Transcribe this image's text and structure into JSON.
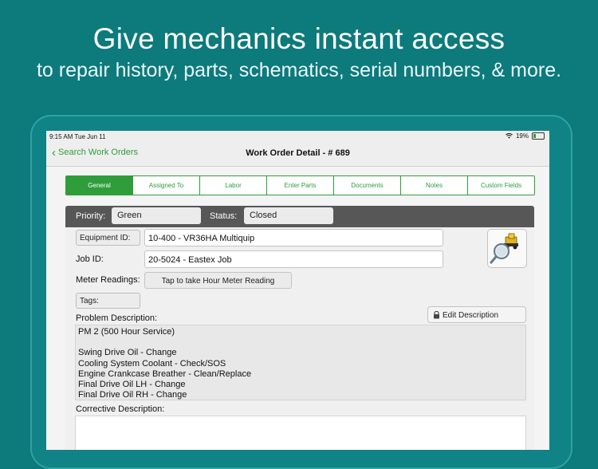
{
  "promo": {
    "title": "Give mechanics instant access",
    "subtitle": "to repair history, parts, schematics, serial numbers, & more."
  },
  "statusbar": {
    "time": "9:15 AM  Tue Jun 11",
    "battery": "19%"
  },
  "nav": {
    "back_label": "Search Work Orders",
    "title": "Work Order Detail - # 689"
  },
  "tabs": [
    {
      "label": "General",
      "active": true
    },
    {
      "label": "Assigned To"
    },
    {
      "label": "Labor"
    },
    {
      "label": "Enter Parts"
    },
    {
      "label": "Documents"
    },
    {
      "label": "Notes"
    },
    {
      "label": "Custom Fields"
    }
  ],
  "header": {
    "priority_label": "Priority:",
    "priority_value": "Green",
    "status_label": "Status:",
    "status_value": "Closed"
  },
  "fields": {
    "equipment_label": "Equipment ID:",
    "equipment_value": "10-400  - VR36HA Multiquip",
    "job_label": "Job ID:",
    "job_value": "20-5024 - Eastex Job",
    "meter_label": "Meter Readings:",
    "meter_button": "Tap to take Hour Meter Reading",
    "tags_label": "Tags:"
  },
  "problem": {
    "label": "Problem Description:",
    "edit_button": "Edit Description",
    "lines": [
      "PM 2 (500 Hour Service)",
      "",
      "Swing Drive Oil - Change",
      "Cooling System Coolant - Check/SOS",
      "Engine Crankcase Breather - Clean/Replace",
      "Final Drive Oil LH - Change",
      "Final Drive Oil RH - Change"
    ]
  },
  "corrective": {
    "label": "Corrective Description:",
    "value": ""
  },
  "colors": {
    "background": "#0d7a7c",
    "accent": "#2e9d3a",
    "header": "#575757"
  }
}
